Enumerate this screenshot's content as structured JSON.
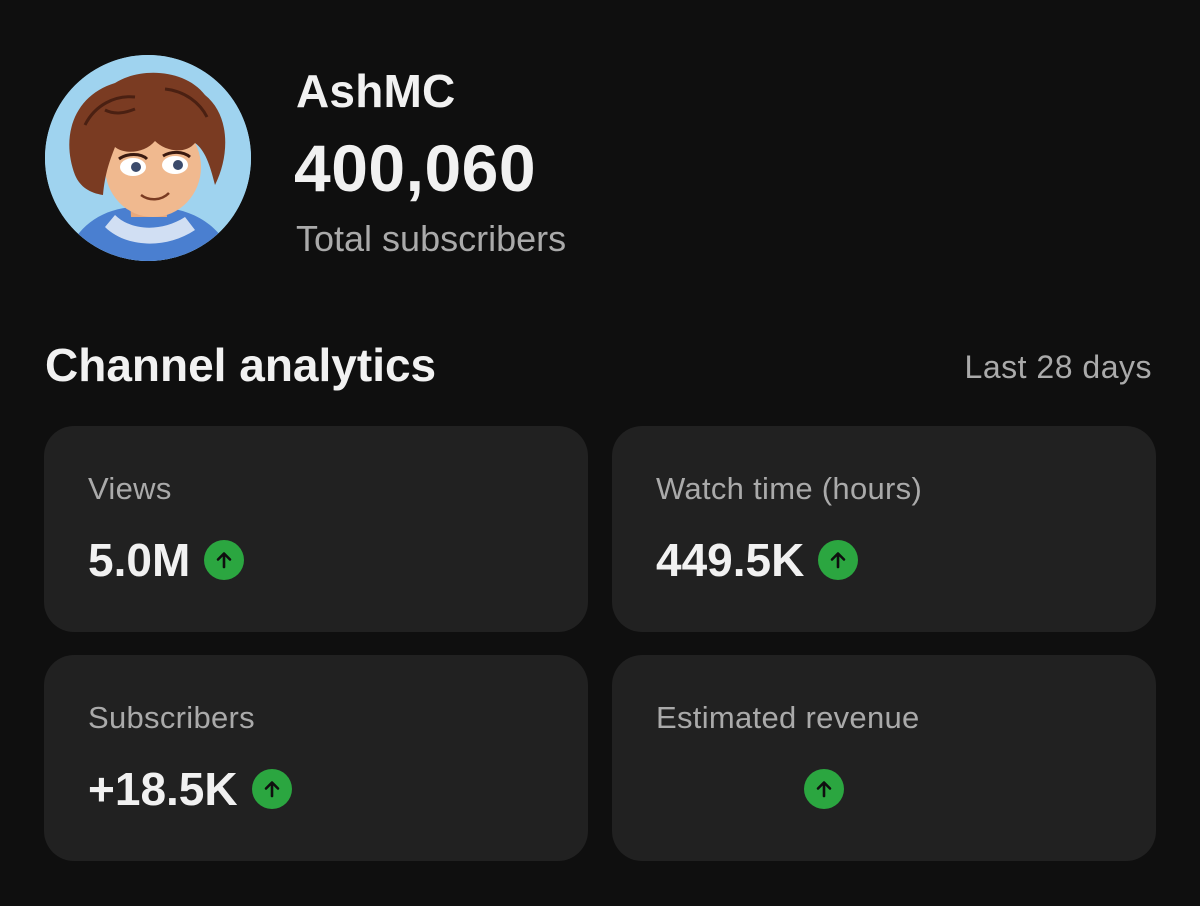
{
  "channel": {
    "name": "AshMC",
    "subscriber_count": "400,060",
    "subscriber_label": "Total subscribers",
    "avatar": "cartoon-avatar-curly-brown-hair"
  },
  "analytics": {
    "title": "Channel analytics",
    "period": "Last 28 days",
    "cards": [
      {
        "label": "Views",
        "value": "5.0M",
        "trend": "up",
        "trend_icon": "arrow-up-icon"
      },
      {
        "label": "Watch time (hours)",
        "value": "449.5K",
        "trend": "up",
        "trend_icon": "arrow-up-icon"
      },
      {
        "label": "Subscribers",
        "value": "+18.5K",
        "trend": "up",
        "trend_icon": "arrow-up-icon"
      },
      {
        "label": "Estimated revenue",
        "value": "",
        "trend": "up",
        "trend_icon": "arrow-up-icon"
      }
    ]
  },
  "colors": {
    "background": "#0f0f0f",
    "card": "#212121",
    "trend_up": "#2ba640",
    "secondary_text": "#aaaaaa"
  }
}
